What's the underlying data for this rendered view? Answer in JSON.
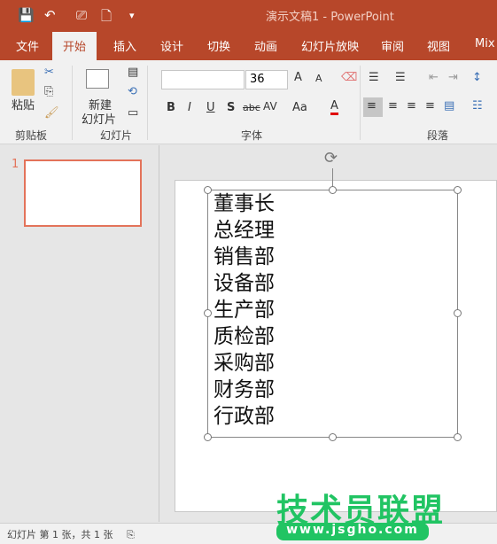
{
  "window": {
    "title": "演示文稿1 - PowerPoint"
  },
  "qat": {
    "save": "💾",
    "undo": "↶",
    "present": "⎚",
    "new": "🗋",
    "more": "▾"
  },
  "tabs": [
    "文件",
    "开始",
    "插入",
    "设计",
    "切换",
    "动画",
    "幻灯片放映",
    "审阅",
    "视图",
    "Mix"
  ],
  "ribbon": {
    "paste": "粘贴",
    "new_slide": "新建",
    "new_slide2": "幻灯片",
    "groups": [
      "剪贴板",
      "幻灯片",
      "字体",
      "段落"
    ],
    "font_name": "",
    "font_size": "36",
    "bold": "B",
    "italic": "I",
    "underline": "U",
    "shadow": "S",
    "strike": "abc",
    "spacing": "AV",
    "case": "Aa",
    "color": "A",
    "grow": "A",
    "shrink": "A"
  },
  "accent": "#b7472a",
  "slides": {
    "number": "1"
  },
  "textbox": {
    "lines": [
      "董事长",
      "总经理",
      "销售部",
      "设备部",
      "生产部",
      "质检部",
      "采购部",
      "财务部",
      "行政部"
    ]
  },
  "status": {
    "text": "幻灯片 第 1 张，共 1 张"
  },
  "watermark": {
    "name": "技术员联盟",
    "url": "www.jsgho.com"
  }
}
